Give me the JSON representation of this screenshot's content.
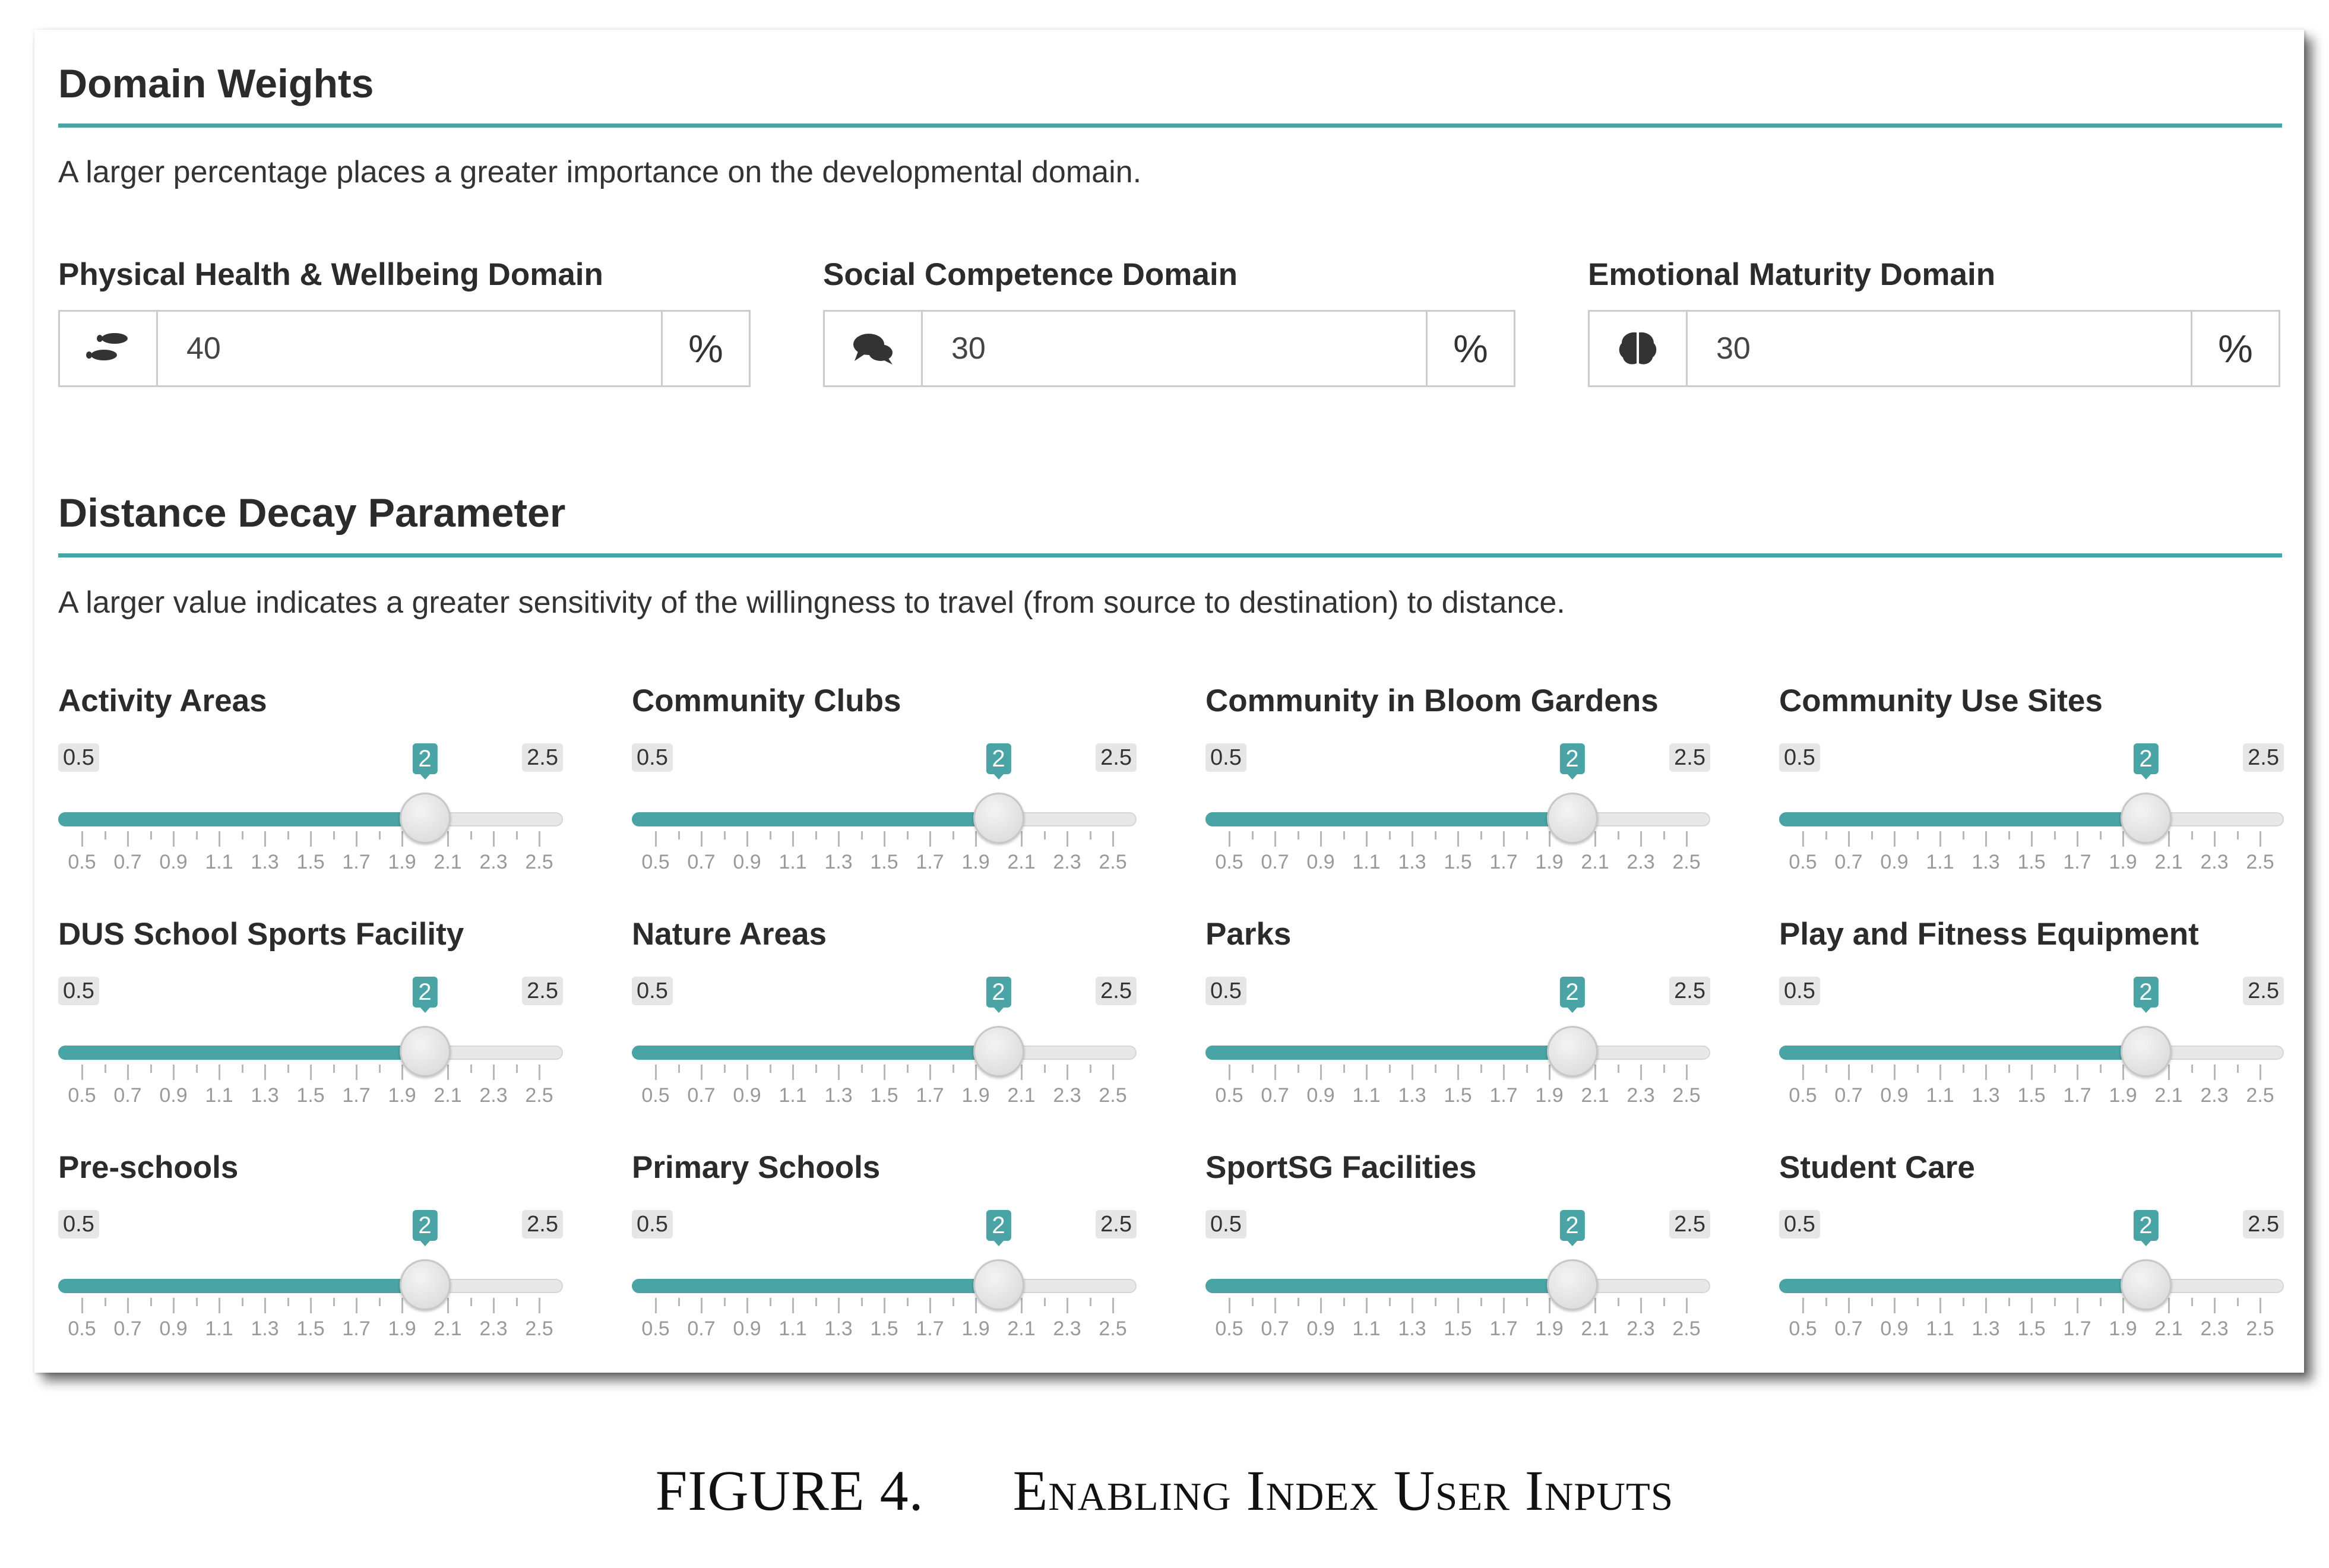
{
  "domain_weights": {
    "title": "Domain Weights",
    "description": "A larger percentage places a greater importance on the developmental domain.",
    "fields": [
      {
        "label": "Physical Health & Wellbeing Domain",
        "icon": "footprints-icon",
        "value": "40",
        "unit": "%"
      },
      {
        "label": "Social Competence Domain",
        "icon": "chat-bubbles-icon",
        "value": "30",
        "unit": "%"
      },
      {
        "label": "Emotional Maturity Domain",
        "icon": "brain-icon",
        "value": "30",
        "unit": "%"
      }
    ]
  },
  "distance_decay": {
    "title": "Distance Decay Parameter",
    "description": "A larger value indicates a greater sensitivity of the willingness to travel (from source to destination) to distance.",
    "min": 0.5,
    "max": 2.5,
    "min_label": "0.5",
    "max_label": "2.5",
    "tick_labels": [
      "0.5",
      "0.7",
      "0.9",
      "1.1",
      "1.3",
      "1.5",
      "1.7",
      "1.9",
      "2.1",
      "2.3",
      "2.5"
    ],
    "sliders": [
      {
        "label": "Activity Areas",
        "value": 2,
        "value_label": "2"
      },
      {
        "label": "Community Clubs",
        "value": 2,
        "value_label": "2"
      },
      {
        "label": "Community in Bloom Gardens",
        "value": 2,
        "value_label": "2"
      },
      {
        "label": "Community Use Sites",
        "value": 2,
        "value_label": "2"
      },
      {
        "label": "DUS School Sports Facility",
        "value": 2,
        "value_label": "2"
      },
      {
        "label": "Nature Areas",
        "value": 2,
        "value_label": "2"
      },
      {
        "label": "Parks",
        "value": 2,
        "value_label": "2"
      },
      {
        "label": "Play and Fitness Equipment",
        "value": 2,
        "value_label": "2"
      },
      {
        "label": "Pre-schools",
        "value": 2,
        "value_label": "2"
      },
      {
        "label": "Primary Schools",
        "value": 2,
        "value_label": "2"
      },
      {
        "label": "SportSG Facilities",
        "value": 2,
        "value_label": "2"
      },
      {
        "label": "Student Care",
        "value": 2,
        "value_label": "2"
      }
    ]
  },
  "colors": {
    "accent": "#4aa3a5",
    "track": "#e8e8e8",
    "text": "#333333"
  },
  "caption": {
    "number": "FIGURE 4.",
    "text": "Enabling Index User Inputs"
  }
}
